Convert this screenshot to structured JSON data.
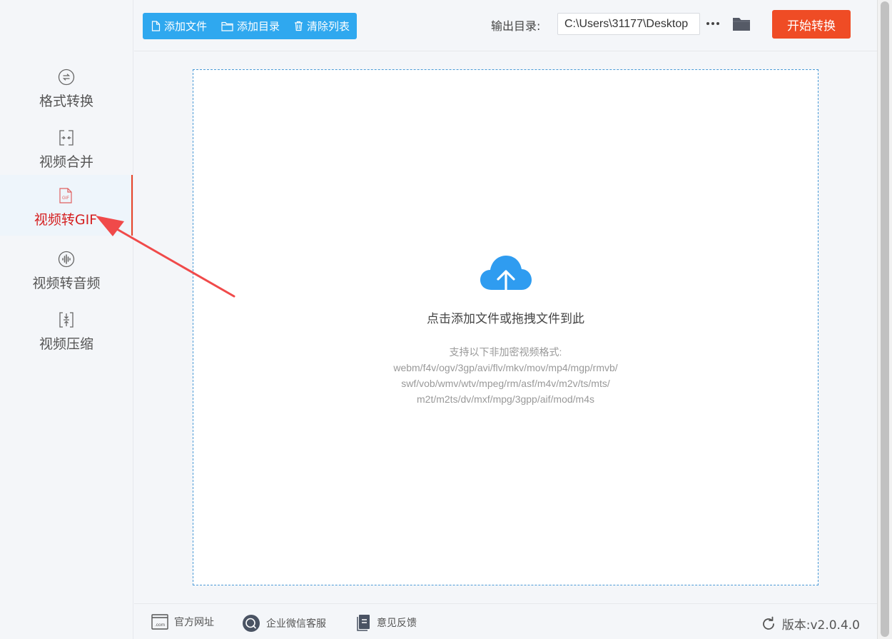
{
  "sidebar": {
    "items": [
      {
        "label": "格式转换",
        "icon": "format-convert-icon",
        "active": false
      },
      {
        "label": "视频合并",
        "icon": "merge-icon",
        "active": false
      },
      {
        "label": "视频转GIF",
        "icon": "gif-file-icon",
        "active": true
      },
      {
        "label": "视频转音频",
        "icon": "audio-wave-icon",
        "active": false
      },
      {
        "label": "视频压缩",
        "icon": "compress-icon",
        "active": false
      }
    ]
  },
  "toolbar": {
    "add_file": "添加文件",
    "add_dir": "添加目录",
    "clear_list": "清除列表",
    "output_label": "输出目录:",
    "output_path": "C:\\Users\\31177\\Desktop",
    "more": "···",
    "start": "开始转换"
  },
  "dropzone": {
    "title": "点击添加文件或拖拽文件到此",
    "formats_heading": "支持以下非加密视频格式:",
    "formats_line1": "webm/f4v/ogv/3gp/avi/flv/mkv/mov/mp4/mgp/rmvb/",
    "formats_line2": "swf/vob/wmv/wtv/mpeg/rm/asf/m4v/m2v/ts/mts/",
    "formats_line3": "m2t/m2ts/dv/mxf/mpg/3gpp/aif/mod/m4s"
  },
  "footer": {
    "website": "官方网址",
    "wechat": "企业微信客服",
    "feedback": "意见反馈",
    "version": "版本:v2.0.4.0"
  },
  "colors": {
    "accent_blue": "#2fa8ef",
    "start_orange": "#ef4c25",
    "active_red": "#d52020",
    "annotation_arrow": "#f04a4a"
  }
}
